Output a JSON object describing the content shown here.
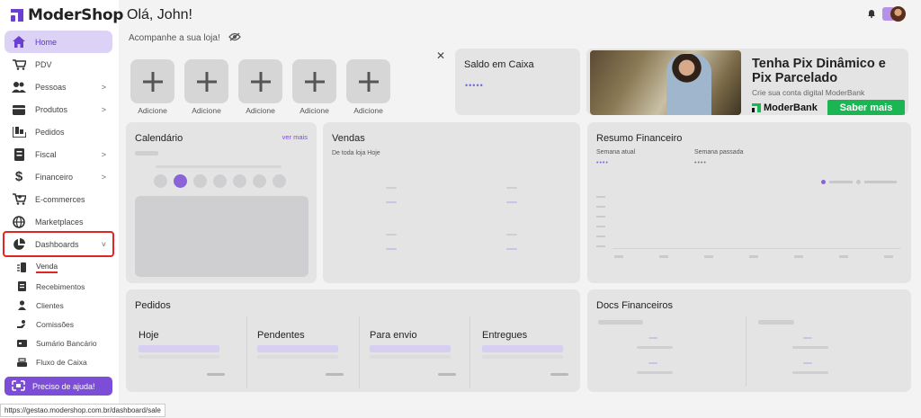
{
  "app": {
    "logo_text": "ModerShop",
    "brand_color": "#6b3fd1"
  },
  "sidebar": {
    "items": [
      {
        "label": "Home",
        "icon": "home-icon",
        "active": true
      },
      {
        "label": "PDV",
        "icon": "cart-icon"
      },
      {
        "label": "Pessoas",
        "icon": "people-icon",
        "chevron": ">"
      },
      {
        "label": "Produtos",
        "icon": "box-icon",
        "chevron": ">"
      },
      {
        "label": "Pedidos",
        "icon": "orders-icon"
      },
      {
        "label": "Fiscal",
        "icon": "fiscal-icon",
        "chevron": ">"
      },
      {
        "label": "Financeiro",
        "icon": "dollar-icon",
        "chevron": ">"
      },
      {
        "label": "E-commerces",
        "icon": "ecommerce-icon"
      },
      {
        "label": "Marketplaces",
        "icon": "globe-icon"
      },
      {
        "label": "Dashboards",
        "icon": "pie-chart-icon",
        "chevron": "˅"
      }
    ],
    "sub_items": [
      {
        "label": "Venda",
        "icon": "sale-icon"
      },
      {
        "label": "Recebimentos",
        "icon": "receipt-icon"
      },
      {
        "label": "Clientes",
        "icon": "client-icon"
      },
      {
        "label": "Comissões",
        "icon": "commission-icon"
      },
      {
        "label": "Sumário Bancário",
        "icon": "bank-icon"
      },
      {
        "label": "Fluxo de Caixa",
        "icon": "cashflow-icon"
      }
    ],
    "help_button": "Preciso de ajuda!"
  },
  "status_bar": {
    "url": "https://gestao.modershop.com.br/dashboard/sale"
  },
  "header": {
    "greeting": "Olá, John!",
    "subline": "Acompanhe a sua loja!"
  },
  "shortcuts": {
    "tile_label": "Adicione",
    "count": 5
  },
  "saldo": {
    "title": "Saldo em Caixa",
    "masked": "•••••"
  },
  "banner": {
    "title": "Tenha Pix Dinâmico e Pix Parcelado",
    "subtitle": "Crie sua conta digital ModerBank",
    "brand": "ModerBank",
    "button": "Saber mais",
    "button_color": "#1cb554"
  },
  "calendario": {
    "title": "Calendário",
    "link": "ver mais"
  },
  "vendas": {
    "title": "Vendas",
    "subtitle": "De toda loja Hoje"
  },
  "resumo": {
    "title": "Resumo Financeiro",
    "col1": "Semana atual",
    "col2": "Semana passada",
    "masked": "••••"
  },
  "pedidos": {
    "title": "Pedidos",
    "columns": [
      "Hoje",
      "Pendentes",
      "Para envio",
      "Entregues"
    ]
  },
  "docs": {
    "title": "Docs Financeiros"
  }
}
